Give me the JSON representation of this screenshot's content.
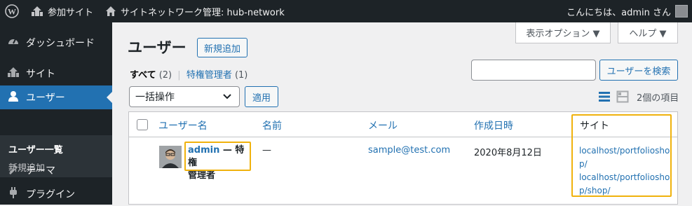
{
  "adminbar": {
    "my_sites": "参加サイト",
    "network": "サイトネットワーク管理: hub-network",
    "greeting": "こんにちは、admin さん"
  },
  "sidebar": {
    "items": [
      {
        "label": "ダッシュボード",
        "icon": "dashboard-icon"
      },
      {
        "label": "サイト",
        "icon": "sites-icon"
      },
      {
        "label": "ユーザー",
        "icon": "users-icon"
      },
      {
        "label": "テーマ",
        "icon": "themes-icon"
      },
      {
        "label": "プラグイン",
        "icon": "plugins-icon"
      }
    ],
    "submenu": [
      "ユーザー一覧",
      "新規追加"
    ]
  },
  "screen_options": "表示オプション ▼",
  "help": "ヘルプ ▼",
  "page": {
    "title": "ユーザー",
    "add_new": "新規追加"
  },
  "filters": {
    "all": "すべて",
    "all_count": "(2)",
    "sep": "|",
    "super": "特権管理者",
    "super_count": "(1)"
  },
  "search": {
    "button": "ユーザーを検索",
    "value": ""
  },
  "bulk": {
    "selected": "一括操作",
    "apply": "適用"
  },
  "item_count": "2個の項目",
  "table": {
    "headers": [
      "ユーザー名",
      "名前",
      "メール",
      "作成日時",
      "サイト"
    ],
    "row": {
      "username": "admin",
      "role_line1": " — 特権",
      "role_line2": "管理者",
      "name": "—",
      "email": "sample@test.com",
      "date": "2020年8月12日",
      "sites": [
        "localhost/portfoliosho",
        "p/",
        "localhost/portfoliosho",
        "p/shop/"
      ]
    }
  },
  "colors": {
    "accent": "#2271b1",
    "highlight": "#f0b20d",
    "bar": "#1d2327"
  }
}
